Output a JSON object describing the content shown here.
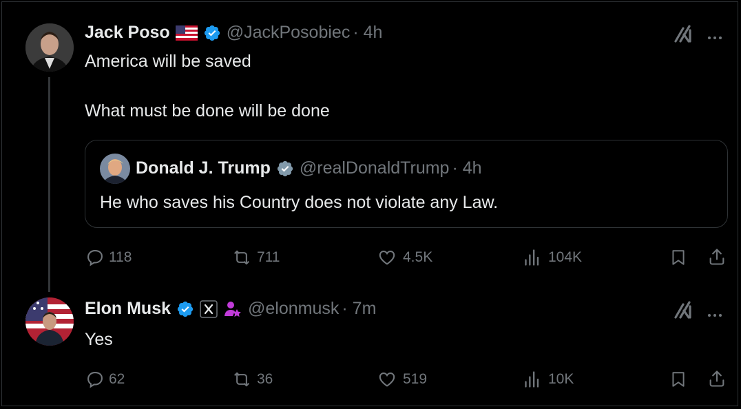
{
  "tweet1": {
    "name": "Jack Poso",
    "handle": "@JackPosobiec",
    "time": "· 4h",
    "lines": [
      "America will be saved",
      "What must be done will be done"
    ],
    "quote": {
      "name": "Donald J. Trump",
      "handle": "@realDonaldTrump",
      "time": "· 4h",
      "text": "He who saves his Country does not violate any Law."
    },
    "stats": {
      "replies": "118",
      "reposts": "711",
      "likes": "4.5K",
      "views": "104K"
    }
  },
  "tweet2": {
    "name": "Elon Musk",
    "handle": "@elonmusk",
    "time": "· 7m",
    "text": "Yes",
    "stats": {
      "replies": "62",
      "reposts": "36",
      "likes": "519",
      "views": "10K"
    }
  },
  "colors": {
    "background": "#000000",
    "text": "#e7e9ea",
    "muted": "#71767b",
    "verified": "#1d9bf0",
    "border": "#2f3336"
  },
  "icons": [
    "grok-icon",
    "more-icon",
    "verified-badge-icon",
    "us-flag-icon",
    "reply-icon",
    "repost-icon",
    "like-icon",
    "views-icon",
    "bookmark-icon",
    "share-icon",
    "x-affiliate-icon",
    "subscriber-icon"
  ]
}
